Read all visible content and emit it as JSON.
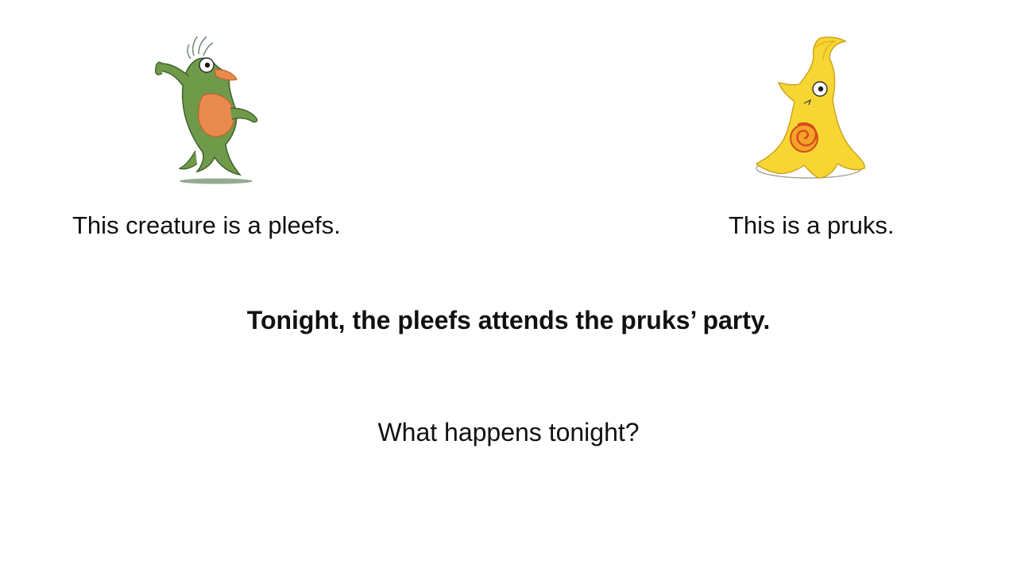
{
  "slide": {
    "left_creature": {
      "caption": "This creature is a pleefs."
    },
    "right_creature": {
      "caption": "This is a pruks."
    },
    "statement": "Tonight, the pleefs attends the pruks’ party.",
    "question": "What happens tonight?"
  },
  "icons": {
    "left_figure": "pleefs-creature-illustration",
    "right_figure": "pruks-creature-illustration"
  },
  "colors": {
    "background": "#ffffff",
    "text": "#111111",
    "pleefs_body": "#6f9a4a",
    "pleefs_belly": "#e98a4e",
    "pruks_body": "#f7d633",
    "pruks_spiral": "#d9481c"
  }
}
